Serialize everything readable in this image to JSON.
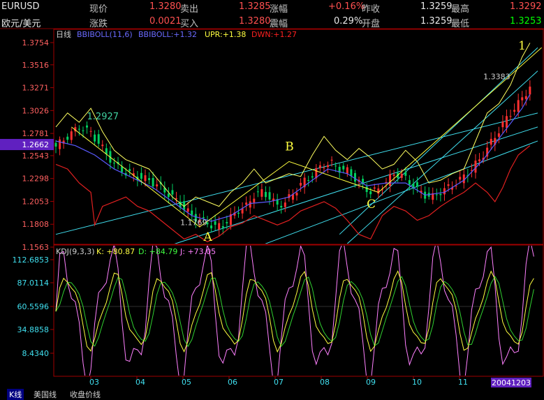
{
  "quote": {
    "symbol": "EURUSD",
    "name": "欧元/美元",
    "last_label": "现价",
    "last": "1.3280",
    "change_label": "涨跌",
    "change": "0.0021",
    "ask_label": "卖出",
    "ask": "1.3285",
    "bid_label": "买入",
    "bid": "1.3280",
    "pct_label": "涨幅",
    "pct": "+0.16%",
    "amp_label": "震幅",
    "amp": "0.29%",
    "prev_label": "昨收",
    "prev": "1.3259",
    "open_label": "开盘",
    "open": "1.3259",
    "high_label": "最高",
    "high": "1.3292",
    "low_label": "最低",
    "low": "1.3253"
  },
  "chart_data": [
    {
      "type": "line",
      "title": "日线",
      "indicator": "BBIBOLL(11,6)",
      "legend": [
        {
          "name": "BBIBOLL",
          "value": "+1.32",
          "color": "#6a6aff"
        },
        {
          "name": "UPR",
          "value": "+1.38",
          "color": "#ffff40"
        },
        {
          "name": "DWN",
          "value": "+1.27",
          "color": "#ff2020"
        }
      ],
      "y_ticks": [
        "1.3754",
        "1.3516",
        "1.3271",
        "1.3026",
        "1.2781",
        "1.2543",
        "1.2298",
        "1.2053",
        "1.1808",
        "1.1563"
      ],
      "current_price": "1.2662",
      "ylim": [
        1.1563,
        1.3754
      ],
      "x_months": [
        "03",
        "04",
        "05",
        "06",
        "07",
        "08",
        "09",
        "10",
        "11"
      ],
      "date_label": "20041203",
      "price_path": [
        [
          0,
          1.264
        ],
        [
          3,
          1.275
        ],
        [
          6,
          1.285
        ],
        [
          9,
          1.279
        ],
        [
          12,
          1.262
        ],
        [
          15,
          1.245
        ],
        [
          18,
          1.236
        ],
        [
          21,
          1.232
        ],
        [
          24,
          1.228
        ],
        [
          27,
          1.22
        ],
        [
          30,
          1.21
        ],
        [
          33,
          1.198
        ],
        [
          35,
          1.19
        ],
        [
          37,
          1.185
        ],
        [
          39,
          1.182
        ],
        [
          41,
          1.178
        ],
        [
          43,
          1.18
        ],
        [
          45,
          1.188
        ],
        [
          47,
          1.196
        ],
        [
          49,
          1.2
        ],
        [
          51,
          1.212
        ],
        [
          53,
          1.215
        ],
        [
          55,
          1.21
        ],
        [
          57,
          1.2
        ],
        [
          59,
          1.205
        ],
        [
          61,
          1.213
        ],
        [
          63,
          1.224
        ],
        [
          65,
          1.23
        ],
        [
          67,
          1.238
        ],
        [
          69,
          1.245
        ],
        [
          71,
          1.246
        ],
        [
          73,
          1.24
        ],
        [
          75,
          1.238
        ],
        [
          77,
          1.23
        ],
        [
          79,
          1.222
        ],
        [
          81,
          1.215
        ],
        [
          83,
          1.218
        ],
        [
          85,
          1.226
        ],
        [
          87,
          1.235
        ],
        [
          89,
          1.233
        ],
        [
          91,
          1.226
        ],
        [
          93,
          1.218
        ],
        [
          95,
          1.212
        ],
        [
          97,
          1.21
        ],
        [
          99,
          1.216
        ],
        [
          101,
          1.22
        ],
        [
          103,
          1.225
        ],
        [
          105,
          1.232
        ],
        [
          107,
          1.24
        ],
        [
          109,
          1.25
        ],
        [
          111,
          1.262
        ],
        [
          113,
          1.275
        ],
        [
          115,
          1.288
        ],
        [
          117,
          1.3
        ],
        [
          119,
          1.31
        ],
        [
          121,
          1.322
        ],
        [
          122,
          1.328
        ]
      ],
      "bbiboll": [
        [
          0,
          1.27
        ],
        [
          5,
          1.265
        ],
        [
          10,
          1.255
        ],
        [
          15,
          1.24
        ],
        [
          20,
          1.23
        ],
        [
          25,
          1.22
        ],
        [
          30,
          1.205
        ],
        [
          35,
          1.19
        ],
        [
          40,
          1.184
        ],
        [
          45,
          1.19
        ],
        [
          50,
          1.203
        ],
        [
          55,
          1.205
        ],
        [
          60,
          1.21
        ],
        [
          65,
          1.225
        ],
        [
          70,
          1.24
        ],
        [
          75,
          1.235
        ],
        [
          80,
          1.222
        ],
        [
          85,
          1.225
        ],
        [
          90,
          1.225
        ],
        [
          95,
          1.212
        ],
        [
          100,
          1.215
        ],
        [
          105,
          1.228
        ],
        [
          110,
          1.25
        ],
        [
          115,
          1.278
        ],
        [
          120,
          1.305
        ],
        [
          122,
          1.32
        ]
      ],
      "upr": [
        [
          0,
          1.285
        ],
        [
          3,
          1.3
        ],
        [
          6,
          1.29
        ],
        [
          9,
          1.305
        ],
        [
          12,
          1.28
        ],
        [
          15,
          1.26
        ],
        [
          18,
          1.25
        ],
        [
          21,
          1.245
        ],
        [
          24,
          1.24
        ],
        [
          27,
          1.225
        ],
        [
          30,
          1.21
        ],
        [
          33,
          1.2
        ],
        [
          36,
          1.21
        ],
        [
          39,
          1.205
        ],
        [
          42,
          1.2
        ],
        [
          45,
          1.215
        ],
        [
          48,
          1.225
        ],
        [
          51,
          1.24
        ],
        [
          54,
          1.225
        ],
        [
          57,
          1.23
        ],
        [
          60,
          1.235
        ],
        [
          63,
          1.232
        ],
        [
          66,
          1.255
        ],
        [
          69,
          1.275
        ],
        [
          72,
          1.26
        ],
        [
          75,
          1.25
        ],
        [
          78,
          1.262
        ],
        [
          81,
          1.252
        ],
        [
          84,
          1.24
        ],
        [
          87,
          1.245
        ],
        [
          90,
          1.26
        ],
        [
          93,
          1.248
        ],
        [
          96,
          1.225
        ],
        [
          99,
          1.228
        ],
        [
          102,
          1.235
        ],
        [
          105,
          1.24
        ],
        [
          108,
          1.27
        ],
        [
          111,
          1.3
        ],
        [
          114,
          1.31
        ],
        [
          117,
          1.33
        ],
        [
          120,
          1.36
        ],
        [
          122,
          1.375
        ]
      ],
      "dwn": [
        [
          0,
          1.245
        ],
        [
          3,
          1.24
        ],
        [
          6,
          1.225
        ],
        [
          9,
          1.215
        ],
        [
          10,
          1.18
        ],
        [
          12,
          1.2
        ],
        [
          15,
          1.205
        ],
        [
          18,
          1.21
        ],
        [
          21,
          1.2
        ],
        [
          24,
          1.195
        ],
        [
          27,
          1.185
        ],
        [
          30,
          1.175
        ],
        [
          33,
          1.165
        ],
        [
          36,
          1.17
        ],
        [
          39,
          1.162
        ],
        [
          42,
          1.168
        ],
        [
          45,
          1.178
        ],
        [
          48,
          1.182
        ],
        [
          51,
          1.19
        ],
        [
          54,
          1.185
        ],
        [
          57,
          1.18
        ],
        [
          60,
          1.185
        ],
        [
          63,
          1.195
        ],
        [
          66,
          1.2
        ],
        [
          69,
          1.205
        ],
        [
          72,
          1.198
        ],
        [
          75,
          1.185
        ],
        [
          78,
          1.17
        ],
        [
          81,
          1.165
        ],
        [
          84,
          1.19
        ],
        [
          87,
          1.2
        ],
        [
          90,
          1.195
        ],
        [
          93,
          1.185
        ],
        [
          96,
          1.19
        ],
        [
          99,
          1.2
        ],
        [
          102,
          1.208
        ],
        [
          105,
          1.215
        ],
        [
          108,
          1.225
        ],
        [
          111,
          1.215
        ],
        [
          113,
          1.205
        ],
        [
          115,
          1.22
        ],
        [
          117,
          1.24
        ],
        [
          119,
          1.255
        ],
        [
          122,
          1.265
        ]
      ],
      "channels": [
        [
          [
            0,
            1.17
          ],
          [
            124,
            1.3
          ]
        ],
        [
          [
            27,
            1.155
          ],
          [
            124,
            1.285
          ]
        ],
        [
          [
            40,
            1.138
          ],
          [
            124,
            1.27
          ]
        ],
        [
          [
            73,
            1.17
          ],
          [
            124,
            1.37
          ]
        ],
        [
          [
            75,
            1.16
          ],
          [
            124,
            1.345
          ]
        ]
      ],
      "trend_lines": [
        [
          [
            4,
            1.285
          ],
          [
            37,
            1.178
          ],
          [
            60,
            1.248
          ],
          [
            83,
            1.215
          ],
          [
            125,
            1.37
          ]
        ]
      ],
      "labels": [
        {
          "text": "A",
          "x": 38,
          "y": 1.163
        },
        {
          "text": "B",
          "x": 59,
          "y": 1.26
        },
        {
          "text": "C",
          "x": 80,
          "y": 1.198
        },
        {
          "text": "1",
          "x": 119,
          "y": 1.368
        }
      ],
      "annotations": [
        {
          "text": "1.2927",
          "x": 8,
          "y": 1.293
        },
        {
          "text": "1.1769",
          "x": 32,
          "y": 1.18
        },
        {
          "text": "1.3383",
          "x": 110,
          "y": 1.336
        }
      ]
    },
    {
      "type": "line",
      "indicator": "KDJ(9,3,3)",
      "legend": [
        {
          "name": "K",
          "value": "+80.87",
          "color": "#ffff40"
        },
        {
          "name": "D",
          "value": "+84.79",
          "color": "#40ff40"
        },
        {
          "name": "J",
          "value": "+73.05",
          "color": "#ff80ff"
        }
      ],
      "y_ticks": [
        "112.6853",
        "87.0114",
        "60.5596",
        "34.8858",
        "8.4340"
      ],
      "ylim": [
        -20,
        120
      ],
      "x_count": 124
    }
  ]
}
